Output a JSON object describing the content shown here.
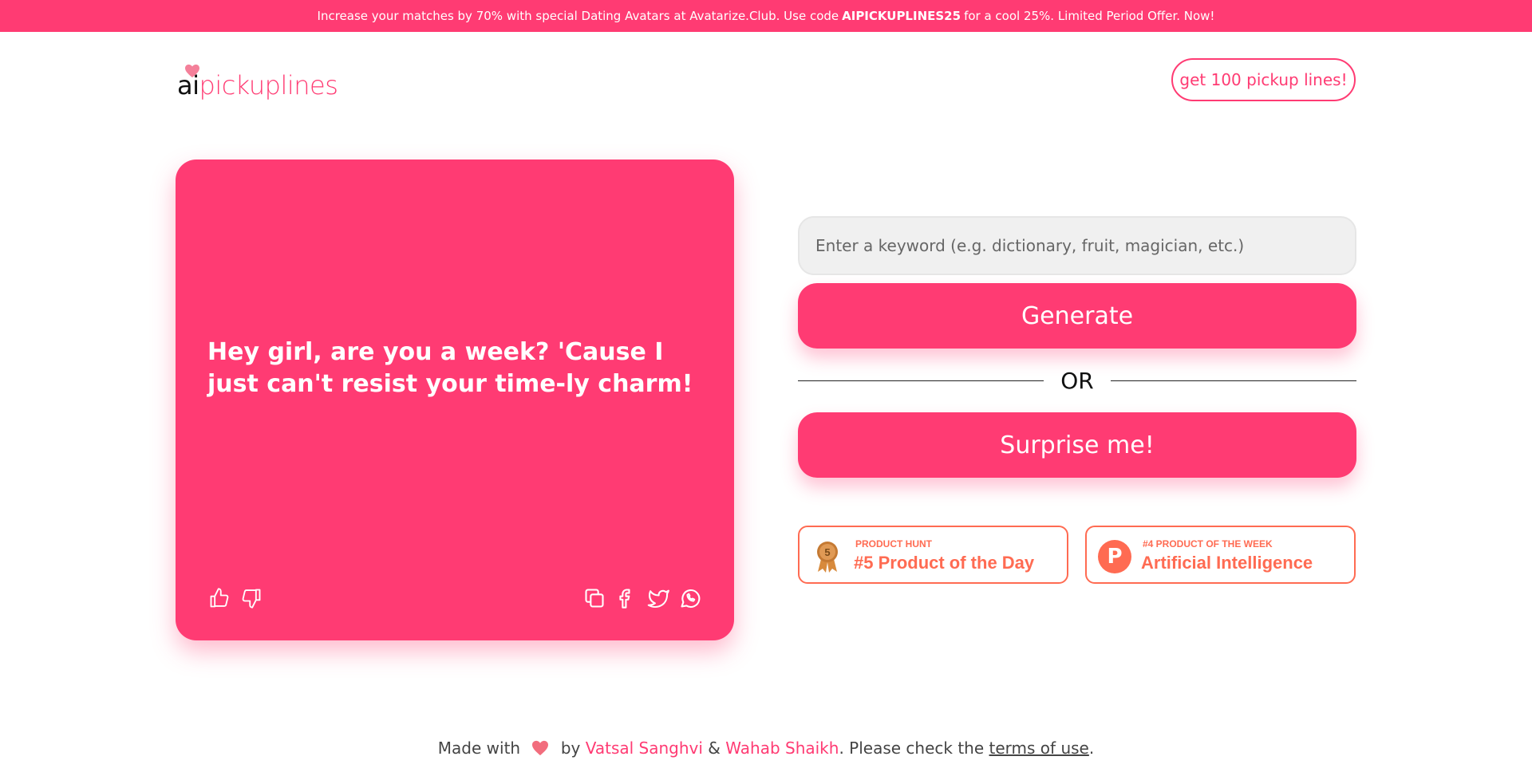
{
  "banner": {
    "text_before": "Increase your matches by 70% with special Dating Avatars at Avatarize.Club. Use code",
    "code": "AIPICKUPLINES25",
    "text_after": "for a cool 25%. Limited Period Offer. Now!"
  },
  "logo": {
    "ai": "ai",
    "rest": "pickuplines"
  },
  "header": {
    "cta_label": "get 100 pickup lines!"
  },
  "card": {
    "pickup_line": "Hey girl, are you a week? 'Cause I just can't resist your time-ly charm!",
    "icons": [
      "thumbs-up-icon",
      "thumbs-down-icon",
      "copy-icon",
      "facebook-icon",
      "twitter-icon",
      "whatsapp-icon"
    ]
  },
  "form": {
    "keyword_placeholder": "Enter a keyword (e.g. dictionary, fruit, magician, etc.)",
    "keyword_value": "",
    "generate_label": "Generate",
    "or_label": "OR",
    "surprise_label": "Surprise me!"
  },
  "badges": [
    {
      "kicker": "PRODUCT HUNT",
      "headline": "#5 Product of the Day",
      "medal_number": "5"
    },
    {
      "kicker": "#4 PRODUCT OF THE WEEK",
      "headline": "Artificial Intelligence",
      "logo_letter": "P"
    }
  ],
  "footer": {
    "made_with": "Made with",
    "by": "by",
    "author1": "Vatsal Sanghvi",
    "amp": "&",
    "author2": "Wahab Shaikh",
    "check": ". Please check the",
    "terms": "terms of use",
    "period": "."
  },
  "colors": {
    "accent": "#ff3b73",
    "badge": "#ff6b52"
  }
}
